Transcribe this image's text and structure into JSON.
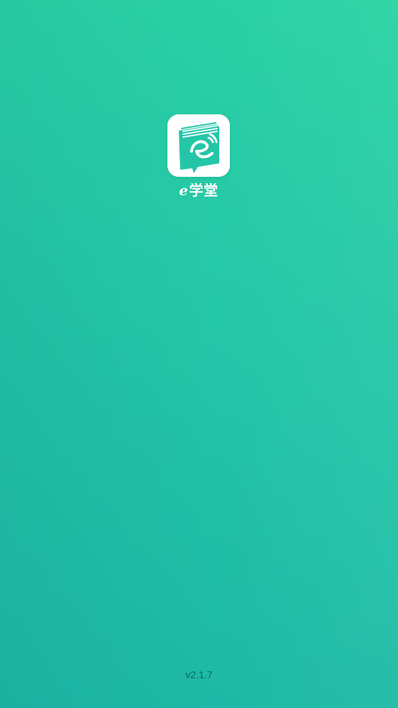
{
  "splash": {
    "app_icon": "book-e-logo-icon",
    "app_name_prefix": "e",
    "app_name_suffix": "学堂",
    "version": "v2.1.7"
  },
  "colors": {
    "background_start": "#2bd3a3",
    "background_end": "#1cb6a5",
    "icon_background": "#ffffff",
    "icon_accent": "#24c6a8",
    "version_text": "rgba(0,0,0,0.45)"
  }
}
